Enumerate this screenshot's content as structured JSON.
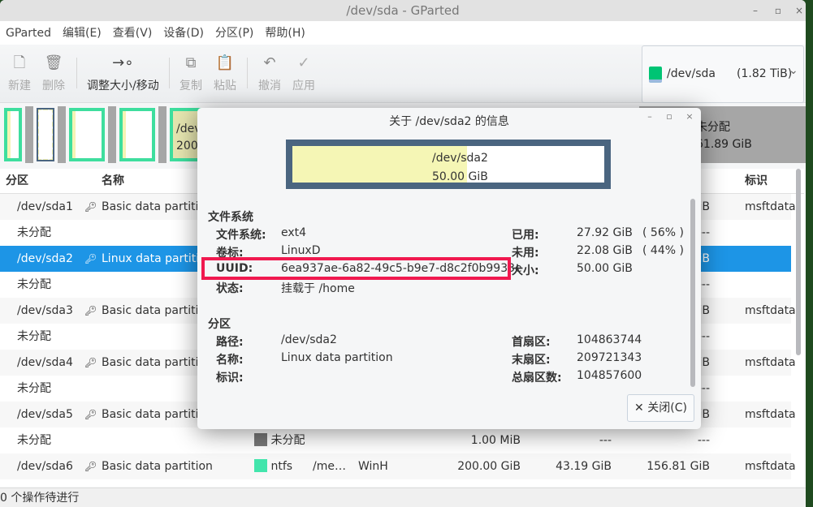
{
  "window": {
    "title": "/dev/sda - GParted",
    "minimize": "–",
    "maximize": "▫",
    "close": "×"
  },
  "menu": [
    "GParted",
    "编辑(E)",
    "查看(V)",
    "设备(D)",
    "分区(P)",
    "帮助(H)"
  ],
  "toolbar": {
    "new": "新建",
    "delete": "删除",
    "resize": "调整大小/移动",
    "copy": "复制",
    "paste": "粘贴",
    "undo": "撤消",
    "apply": "应用"
  },
  "device": {
    "name": "/dev/sda",
    "size": "(1.82 TiB)"
  },
  "pbar": {
    "sda2_name": "/dev",
    "sda2_size": "200",
    "unalloc_name": "未分配",
    "unalloc_size": "61.89 GiB"
  },
  "colors": {
    "ext4": "#3ede9e",
    "ntfs": "#42e5ac",
    "unallocated": "#a6a6a6",
    "selected": "#1d95e6",
    "highlight": "#f0194f"
  },
  "table": {
    "headers": {
      "partition": "分区",
      "name": "名称",
      "flags": "标识"
    },
    "rows": [
      {
        "partition": "/dev/sda1",
        "name": "Basic data partition",
        "tail": "iB",
        "flags": "msftdata"
      },
      {
        "partition": "未分配",
        "tail": "---"
      },
      {
        "partition": "/dev/sda2",
        "name": "Linux data partition",
        "tail": "iB",
        "selected": true
      },
      {
        "partition": "未分配",
        "tail": "---"
      },
      {
        "partition": "/dev/sda3",
        "name": "Basic data partition",
        "tail": "iB",
        "flags": "msftdata"
      },
      {
        "partition": "未分配",
        "tail": "---"
      },
      {
        "partition": "/dev/sda4",
        "name": "Basic data partition",
        "tail": "iB",
        "flags": "msftdata"
      },
      {
        "partition": "未分配",
        "tail": "---"
      },
      {
        "partition": "/dev/sda5",
        "name": "Basic data partition",
        "tail": "iB",
        "flags": "msftdata"
      },
      {
        "partition": "未分配",
        "fs": "未分配",
        "size": "1.00 MiB",
        "used": "---",
        "unused": "---"
      },
      {
        "partition": "/dev/sda6",
        "name": "Basic data partition",
        "fs": "ntfs",
        "mount": "/me…",
        "label": "WinH",
        "size": "200.00 GiB",
        "used": "43.19 GiB",
        "unused": "156.81 GiB",
        "flags": "msftdata"
      }
    ]
  },
  "status": "0 个操作待进行",
  "dialog": {
    "title": "关于 /dev/sda2 的信息",
    "graph": {
      "name": "/dev/sda2",
      "size": "50.00 GiB",
      "used_percent": 56
    },
    "fs_section": "文件系统",
    "fs": {
      "filesystem_label": "文件系统:",
      "filesystem": "ext4",
      "volume_label": "卷标:",
      "volume": "LinuxD",
      "uuid_label": "UUID:",
      "uuid": "6ea937ae-6a82-49c5-b9e7-d8c2f0b9933e",
      "state_label": "状态:",
      "state": "挂载于 /home",
      "used_label": "已用:",
      "used": "27.92 GiB",
      "used_pct": "( 56% )",
      "unused_label": "未用:",
      "unused": "22.08 GiB",
      "unused_pct": "( 44% )",
      "size_label": "大小:",
      "size": "50.00 GiB"
    },
    "part_section": "分区",
    "part": {
      "path_label": "路径:",
      "path": "/dev/sda2",
      "name_label": "名称:",
      "name": "Linux data partition",
      "flags_label": "标识:",
      "first_label": "首扇区:",
      "first": "104863744",
      "last_label": "末扇区:",
      "last": "209721343",
      "total_label": "总扇区数:",
      "total": "104857600"
    },
    "close": "关闭(C)"
  }
}
